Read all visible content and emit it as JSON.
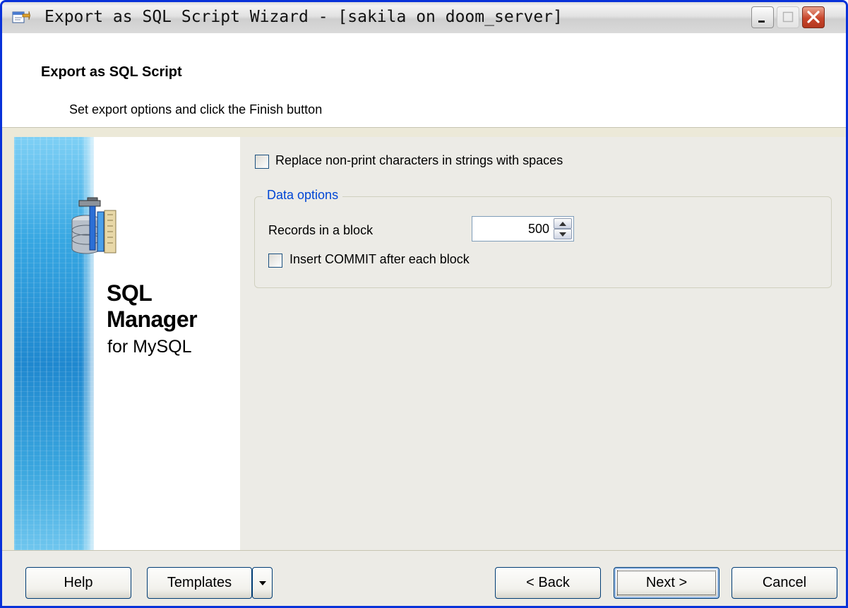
{
  "window": {
    "title": "Export as SQL Script Wizard - [sakila on doom_server]"
  },
  "header": {
    "title": "Export as SQL Script",
    "subtitle": "Set export options and click the Finish button"
  },
  "banner": {
    "brand_line1": "SQL",
    "brand_line2": "Manager",
    "brand_line3": "for MySQL"
  },
  "options": {
    "replace_nonprint": {
      "label": "Replace non-print characters in strings with spaces",
      "checked": false
    }
  },
  "data_options": {
    "legend": "Data options",
    "records_label": "Records in a block",
    "records_value": "500",
    "insert_commit": {
      "label": "Insert COMMIT after each block",
      "checked": false
    }
  },
  "footer": {
    "help": "Help",
    "templates": "Templates",
    "back": "< Back",
    "next": "Next >",
    "cancel": "Cancel"
  },
  "colors": {
    "title_border": "#0831d9",
    "legend_blue": "#0046d5",
    "close_red": "#c8452b"
  }
}
